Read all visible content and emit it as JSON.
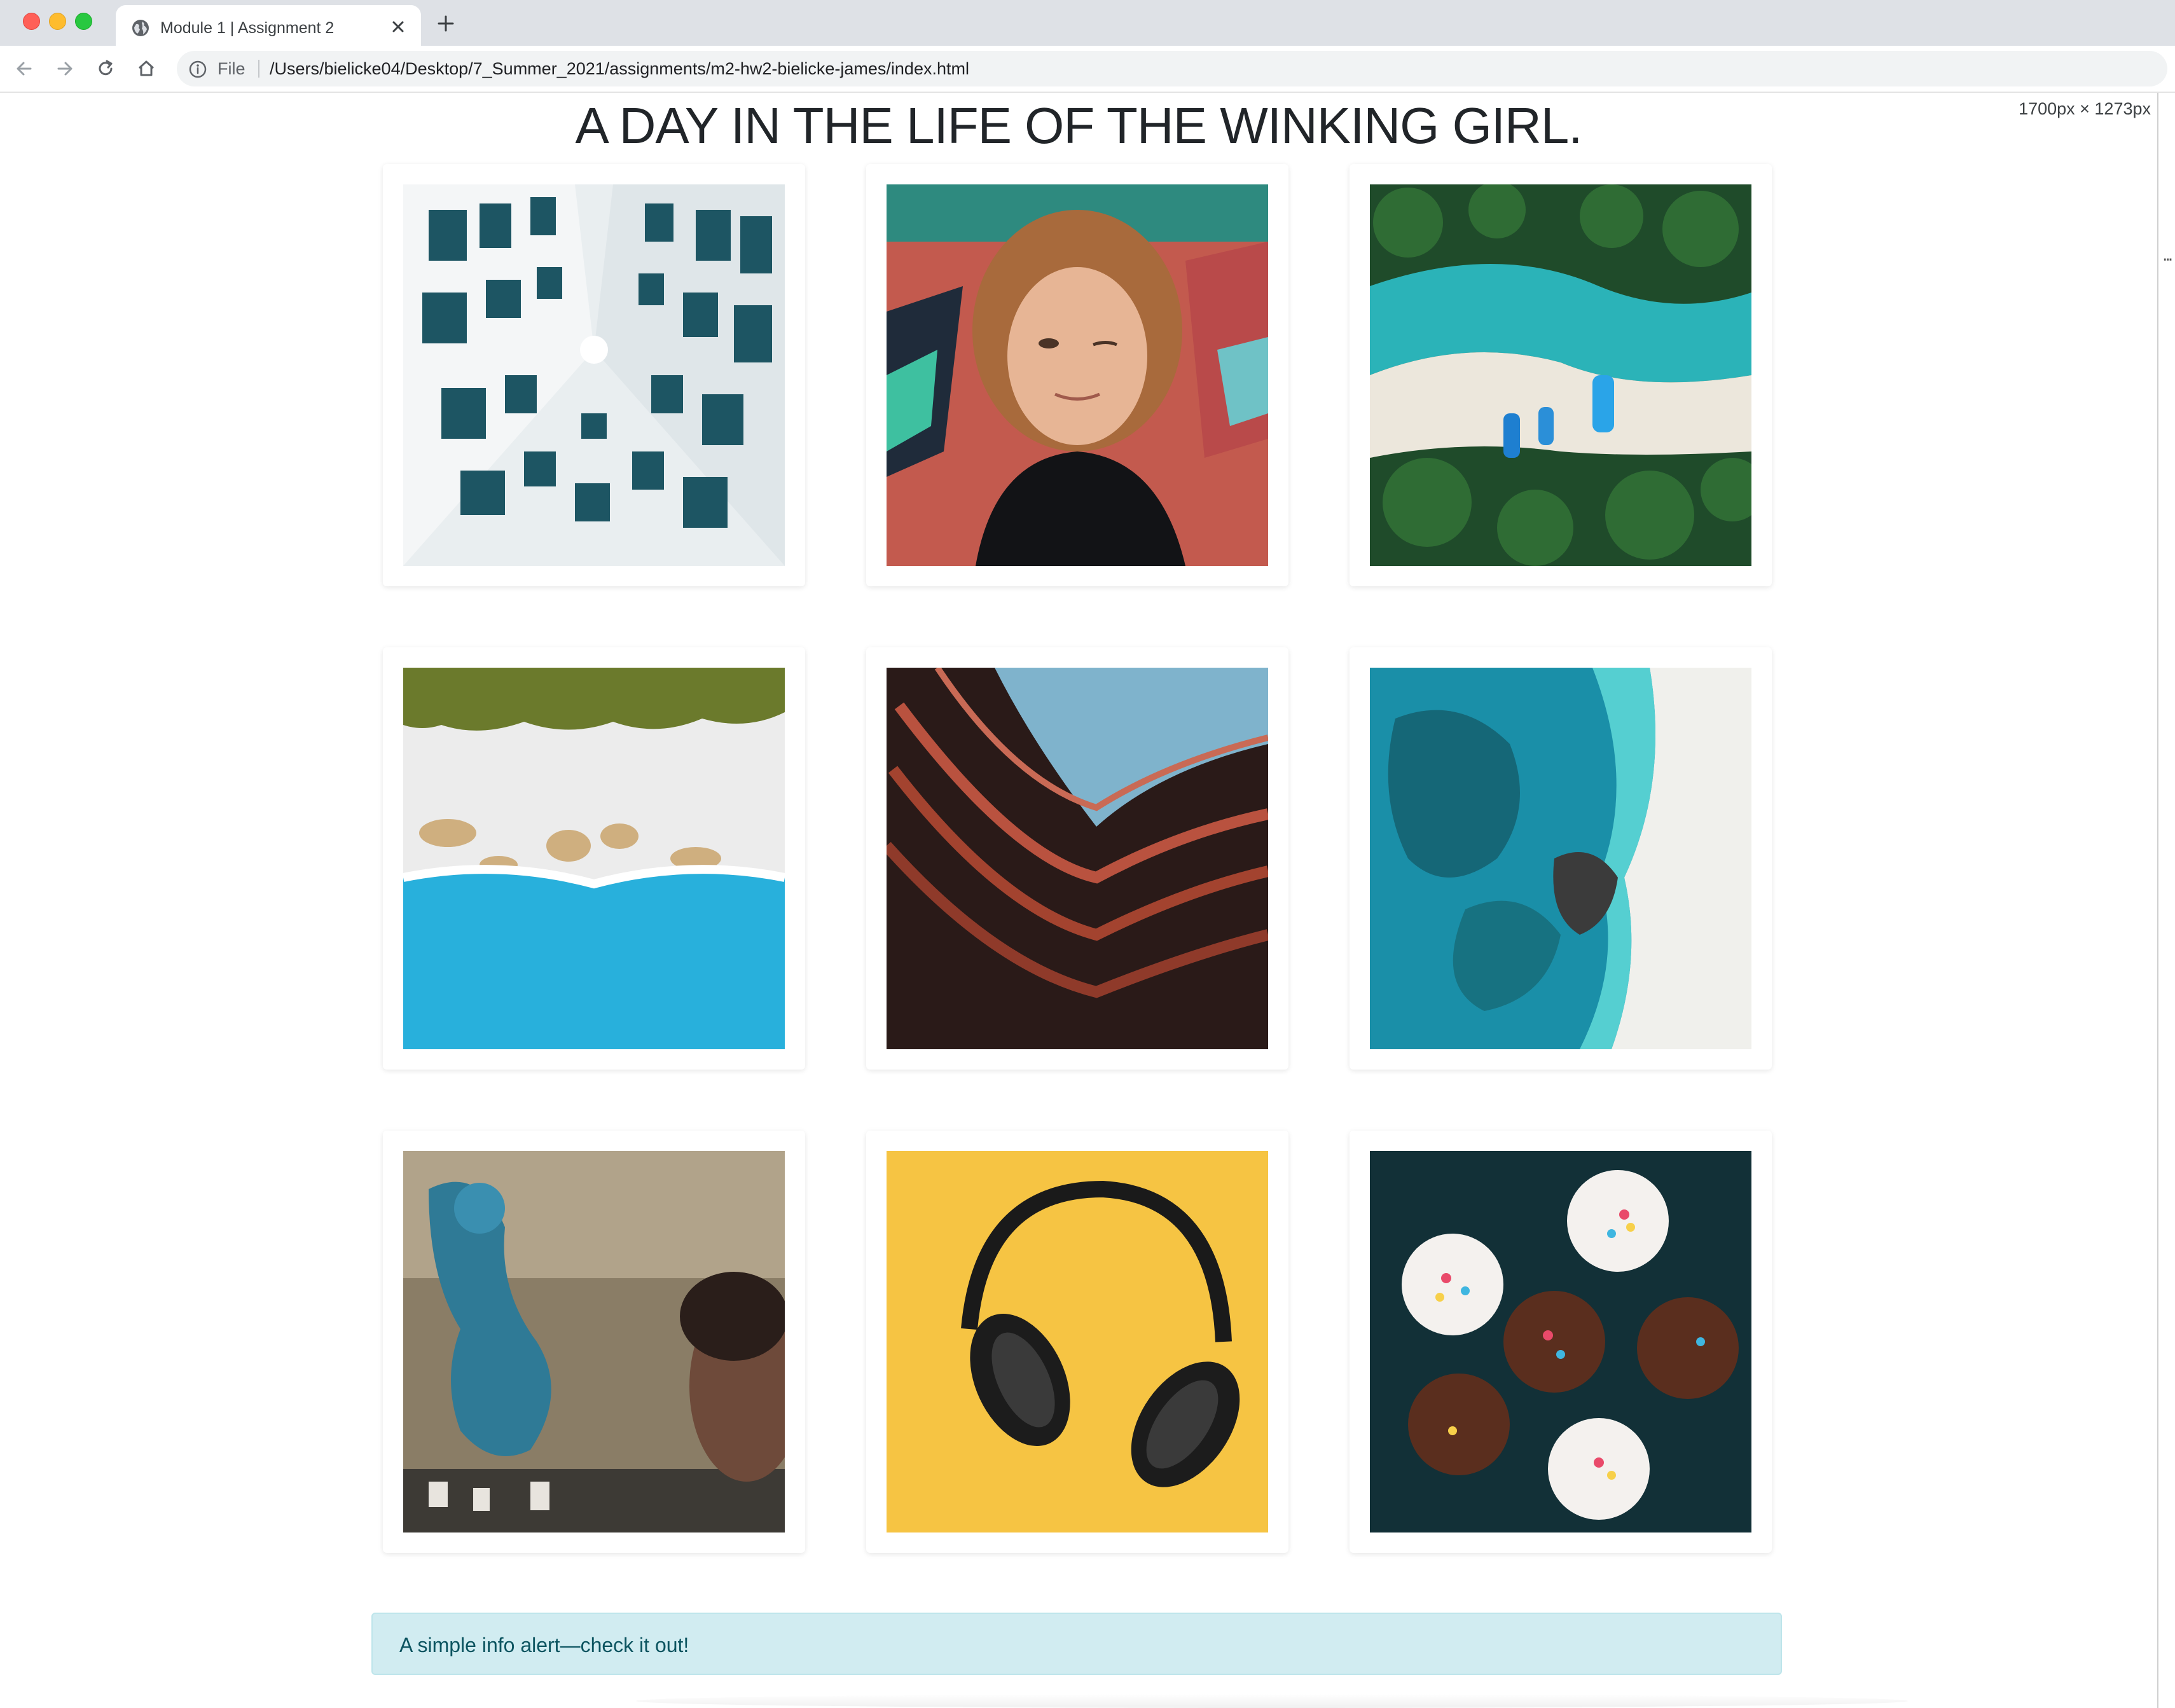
{
  "browser": {
    "tab_title": "Module 1 | Assignment 2",
    "new_tab_label": "+",
    "address_scheme_label": "File",
    "url": "/Users/bielicke04/Desktop/7_Summer_2021/assignments/m2-hw2-bielicke-james/index.html"
  },
  "viewport_badge": "1700px × 1273px",
  "page": {
    "title": "A DAY IN THE LIFE OF THE WINKING GIRL.",
    "gallery": [
      {
        "subject": "looking-up-white-building-windows"
      },
      {
        "subject": "winking-girl-portrait"
      },
      {
        "subject": "aerial-beach-boats-palms"
      },
      {
        "subject": "aerial-shoreline-trees-turquoise-water"
      },
      {
        "subject": "curved-red-building-facade"
      },
      {
        "subject": "aerial-reef-beach-rocks"
      },
      {
        "subject": "street-mural-mermaid-girl"
      },
      {
        "subject": "headphones-yellow-background"
      },
      {
        "subject": "cupcakes-sprinkles"
      }
    ],
    "alert_text": "A simple info alert—check it out!"
  }
}
